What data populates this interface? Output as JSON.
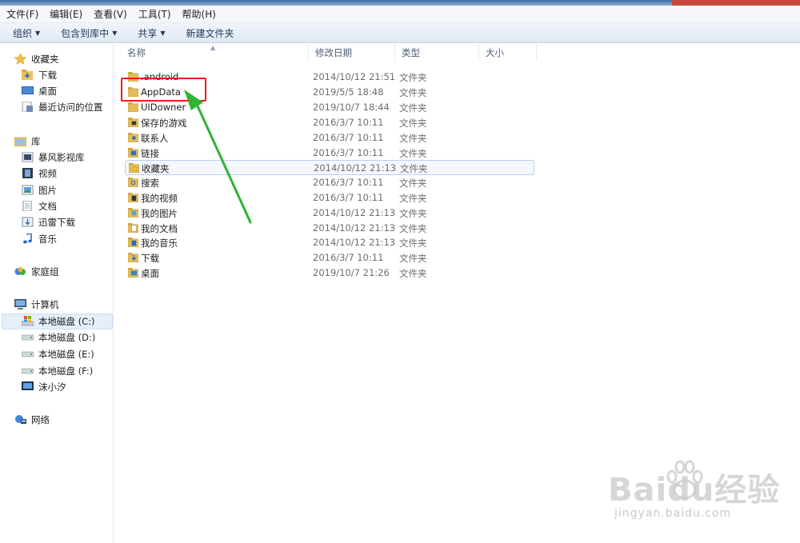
{
  "menu": [
    "文件(F)",
    "编辑(E)",
    "查看(V)",
    "工具(T)",
    "帮助(H)"
  ],
  "toolbar": {
    "organize": "组织",
    "include_in_library": "包含到库中",
    "share": "共享",
    "new_folder": "新建文件夹"
  },
  "nav": {
    "favorites": {
      "label": "收藏夹",
      "items": [
        "下载",
        "桌面",
        "最近访问的位置"
      ]
    },
    "libraries": {
      "label": "库",
      "items": [
        "暴风影视库",
        "视频",
        "图片",
        "文档",
        "迅雷下载",
        "音乐"
      ]
    },
    "homegroup": "家庭组",
    "computer": {
      "label": "计算机",
      "items": [
        "本地磁盘 (C:)",
        "本地磁盘 (D:)",
        "本地磁盘 (E:)",
        "本地磁盘 (F:)",
        "沫小汐"
      ]
    },
    "network": "网络"
  },
  "columns": {
    "name": "名称",
    "modified": "修改日期",
    "type": "类型",
    "size": "大小"
  },
  "files": [
    {
      "name": ".android",
      "date": "2014/10/12 21:51",
      "type": "文件夹",
      "icon": "folder-icon"
    },
    {
      "name": "AppData",
      "date": "2019/5/5 18:48",
      "type": "文件夹",
      "icon": "folder-icon"
    },
    {
      "name": "UIDowner",
      "date": "2019/10/7 18:44",
      "type": "文件夹",
      "icon": "folder-icon"
    },
    {
      "name": "保存的游戏",
      "date": "2016/3/7 10:11",
      "type": "文件夹",
      "icon": "saved-games-icon"
    },
    {
      "name": "联系人",
      "date": "2016/3/7 10:11",
      "type": "文件夹",
      "icon": "contacts-icon"
    },
    {
      "name": "链接",
      "date": "2016/3/7 10:11",
      "type": "文件夹",
      "icon": "links-icon"
    },
    {
      "name": "收藏夹",
      "date": "2014/10/12 21:13",
      "type": "文件夹",
      "icon": "favorites-folder-icon"
    },
    {
      "name": "搜索",
      "date": "2016/3/7 10:11",
      "type": "文件夹",
      "icon": "searches-icon"
    },
    {
      "name": "我的视频",
      "date": "2016/3/7 10:11",
      "type": "文件夹",
      "icon": "videos-folder-icon"
    },
    {
      "name": "我的图片",
      "date": "2014/10/12 21:13",
      "type": "文件夹",
      "icon": "pictures-folder-icon"
    },
    {
      "name": "我的文档",
      "date": "2014/10/12 21:13",
      "type": "文件夹",
      "icon": "documents-folder-icon"
    },
    {
      "name": "我的音乐",
      "date": "2014/10/12 21:13",
      "type": "文件夹",
      "icon": "music-folder-icon"
    },
    {
      "name": "下载",
      "date": "2016/3/7 10:11",
      "type": "文件夹",
      "icon": "downloads-folder-icon"
    },
    {
      "name": "桌面",
      "date": "2019/10/7 21:26",
      "type": "文件夹",
      "icon": "desktop-folder-icon"
    }
  ],
  "colors": {
    "annotation_box": "#ee1c1c",
    "annotation_arrow": "#2db534",
    "accent": "#1e395b"
  },
  "watermark": {
    "brand": "Baidu经验",
    "url": "jingyan.baidu.com"
  }
}
